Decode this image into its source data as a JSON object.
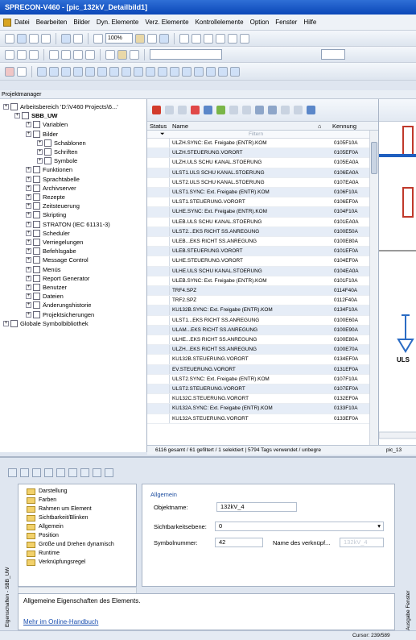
{
  "window": {
    "title": "SPRECON-V460 - [pic_132kV_Detailbild1]"
  },
  "menu": {
    "items": [
      "Datei",
      "Bearbeiten",
      "Bilder",
      "Dyn. Elemente",
      "Verz. Elemente",
      "Kontrollelemente",
      "Option",
      "Fenster",
      "Hilfe"
    ]
  },
  "toolbar": {
    "zoom": "100%"
  },
  "panel": {
    "title": "Projektmanager"
  },
  "tree": {
    "nodes": [
      {
        "label": "Arbeitsbereich 'D:\\V460 Projects\\6...'",
        "level": 0
      },
      {
        "label": "SBB_UW",
        "level": 1,
        "bold": true
      },
      {
        "label": "Variablen",
        "level": 2
      },
      {
        "label": "Bilder",
        "level": 2
      },
      {
        "label": "Schablonen",
        "level": 3
      },
      {
        "label": "Schriften",
        "level": 3
      },
      {
        "label": "Symbole",
        "level": 3
      },
      {
        "label": "Funktionen",
        "level": 2
      },
      {
        "label": "Sprachtabelle",
        "level": 2
      },
      {
        "label": "Archivserver",
        "level": 2
      },
      {
        "label": "Rezepte",
        "level": 2
      },
      {
        "label": "Zeitsteuerung",
        "level": 2
      },
      {
        "label": "Skripting",
        "level": 2
      },
      {
        "label": "STRATON (IEC 61131-3)",
        "level": 2
      },
      {
        "label": "Scheduler",
        "level": 2
      },
      {
        "label": "Verriegelungen",
        "level": 2
      },
      {
        "label": "Befehlsgabe",
        "level": 2
      },
      {
        "label": "Message Control",
        "level": 2
      },
      {
        "label": "Menüs",
        "level": 2
      },
      {
        "label": "Report Generator",
        "level": 2
      },
      {
        "label": "Benutzer",
        "level": 2
      },
      {
        "label": "Dateien",
        "level": 2
      },
      {
        "label": "Änderungshistorie",
        "level": 2
      },
      {
        "label": "Projektsicherungen",
        "level": 2
      },
      {
        "label": "Globale Symbolbibliothek",
        "level": 0
      }
    ]
  },
  "grid": {
    "headers": {
      "status": "Status",
      "name": "Name",
      "kennung": "Kennung"
    },
    "filter_placeholder": "Filtern",
    "rows": [
      {
        "name": "ULZH.SYNC: Ext. Freigabe (ENTR).KOM",
        "kennung": "0105F10A"
      },
      {
        "name": "ULZH.STEUERUNG.VORORT",
        "kennung": "0105EF0A"
      },
      {
        "name": "ULZH.ULS SCHU KANAL.STOERUNG",
        "kennung": "0105EA0A"
      },
      {
        "name": "ULST1.ULS SCHU KANAL.STOERUNG",
        "kennung": "0106EA0A"
      },
      {
        "name": "ULST2.ULS SCHU KANAL.STOERUNG",
        "kennung": "0107EA0A"
      },
      {
        "name": "ULST1.SYNC: Ext. Freigabe (ENTR).KOM",
        "kennung": "0106F10A"
      },
      {
        "name": "ULST1.STEUERUNG.VORORT",
        "kennung": "0106EF0A"
      },
      {
        "name": "ULHE.SYNC: Ext. Freigabe (ENTR).KOM",
        "kennung": "0104F10A"
      },
      {
        "name": "ULEB.ULS SCHU KANAL.STOERUNG",
        "kennung": "0101EA0A"
      },
      {
        "name": "ULST2...EKS RICHT SS.ANREGUNG",
        "kennung": "0100E50A"
      },
      {
        "name": "ULEB...EKS RICHT SS.ANREGUNG",
        "kennung": "0100E80A"
      },
      {
        "name": "ULEB.STEUERUNG.VORORT",
        "kennung": "0101EF0A"
      },
      {
        "name": "ULHE.STEUERUNG.VORORT",
        "kennung": "0104EF0A"
      },
      {
        "name": "ULHE.ULS SCHU KANAL.STOERUNG",
        "kennung": "0104EA0A"
      },
      {
        "name": "ULEB.SYNC: Ext. Freigabe (ENTR).KOM",
        "kennung": "0101F10A"
      },
      {
        "name": "TRF4.SPZ",
        "kennung": "0114F40A"
      },
      {
        "name": "TRF2.SPZ",
        "kennung": "0112F40A"
      },
      {
        "name": "KU132B.SYNC: Ext. Freigabe (ENTR).KOM",
        "kennung": "0134F10A"
      },
      {
        "name": "ULST1...EKS RICHT SS.ANREGUNG",
        "kennung": "0100E60A"
      },
      {
        "name": "ULAM...EKS RICHT SS.ANREGUNG",
        "kennung": "0100E90A"
      },
      {
        "name": "ULHE...EKS RICHT SS.ANREGUNG",
        "kennung": "0100E80A"
      },
      {
        "name": "ULZH...EKS RICHT SS.ANREGUNG",
        "kennung": "0100E70A"
      },
      {
        "name": "KU132B.STEUERUNG.VORORT",
        "kennung": "0134EF0A"
      },
      {
        "name": "EV.STEUERUNG.VORORT",
        "kennung": "0131EF0A"
      },
      {
        "name": "ULST2.SYNC: Ext. Freigabe (ENTR).KOM",
        "kennung": "0107F10A"
      },
      {
        "name": "ULST2.STEUERUNG.VORORT",
        "kennung": "0107EF0A"
      },
      {
        "name": "KU132C.STEUERUNG.VORORT",
        "kennung": "0132EF0A"
      },
      {
        "name": "KU132A.SYNC: Ext. Freigabe (ENTR).KOM",
        "kennung": "0133F10A"
      },
      {
        "name": "KU132A.STEUERUNG.VORORT",
        "kennung": "0133EF0A"
      }
    ],
    "status_text": "6116 gesamt / 61 gefiltert / 1 selektiert | 5794 Tags verwendet / unbegre",
    "right_tab": "pic_13"
  },
  "props": {
    "tree": [
      "Darstellung",
      "Farben",
      "Rahmen um Element",
      "Sichtbarkeit/Blinken",
      "Allgemein",
      "Position",
      "Größe und Drehen dynamisch",
      "Runtime",
      "Verknüpfungsregel"
    ],
    "group_title": "Allgemein",
    "fields": {
      "objname_label": "Objektname:",
      "objname_value": "132kV_4",
      "vis_label": "Sichtbarkeitsebene:",
      "vis_value": "0",
      "sym_label": "Symbolnummer:",
      "sym_value": "42",
      "link_label": "Name des verknüpf...",
      "link_value": "132kV_4"
    },
    "description": "Allgemeine Eigenschaften des Elements.",
    "help_link": "Mehr im Online-Handbuch",
    "side_label_1": "Eigenschaften - SBB_UW",
    "side_label_2": "Ausgabe Fenster"
  },
  "status": {
    "cursor": "Cursor: 239/589"
  }
}
